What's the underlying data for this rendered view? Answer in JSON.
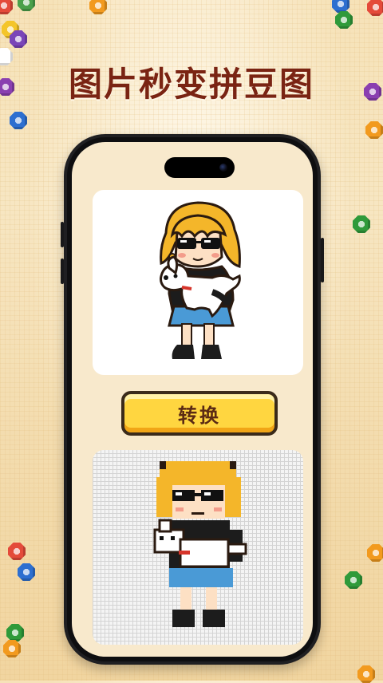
{
  "headline": "图片秒变拼豆图",
  "convert_button_label": "转换",
  "icons": {
    "original_image": "cartoon-girl-with-dog",
    "result_image": "pixel-bead-girl-with-dog"
  },
  "colors": {
    "headline": "#7a2413",
    "button_fill": "#ffd640",
    "button_text": "#5a2a14",
    "background": "#f6e2b8"
  }
}
